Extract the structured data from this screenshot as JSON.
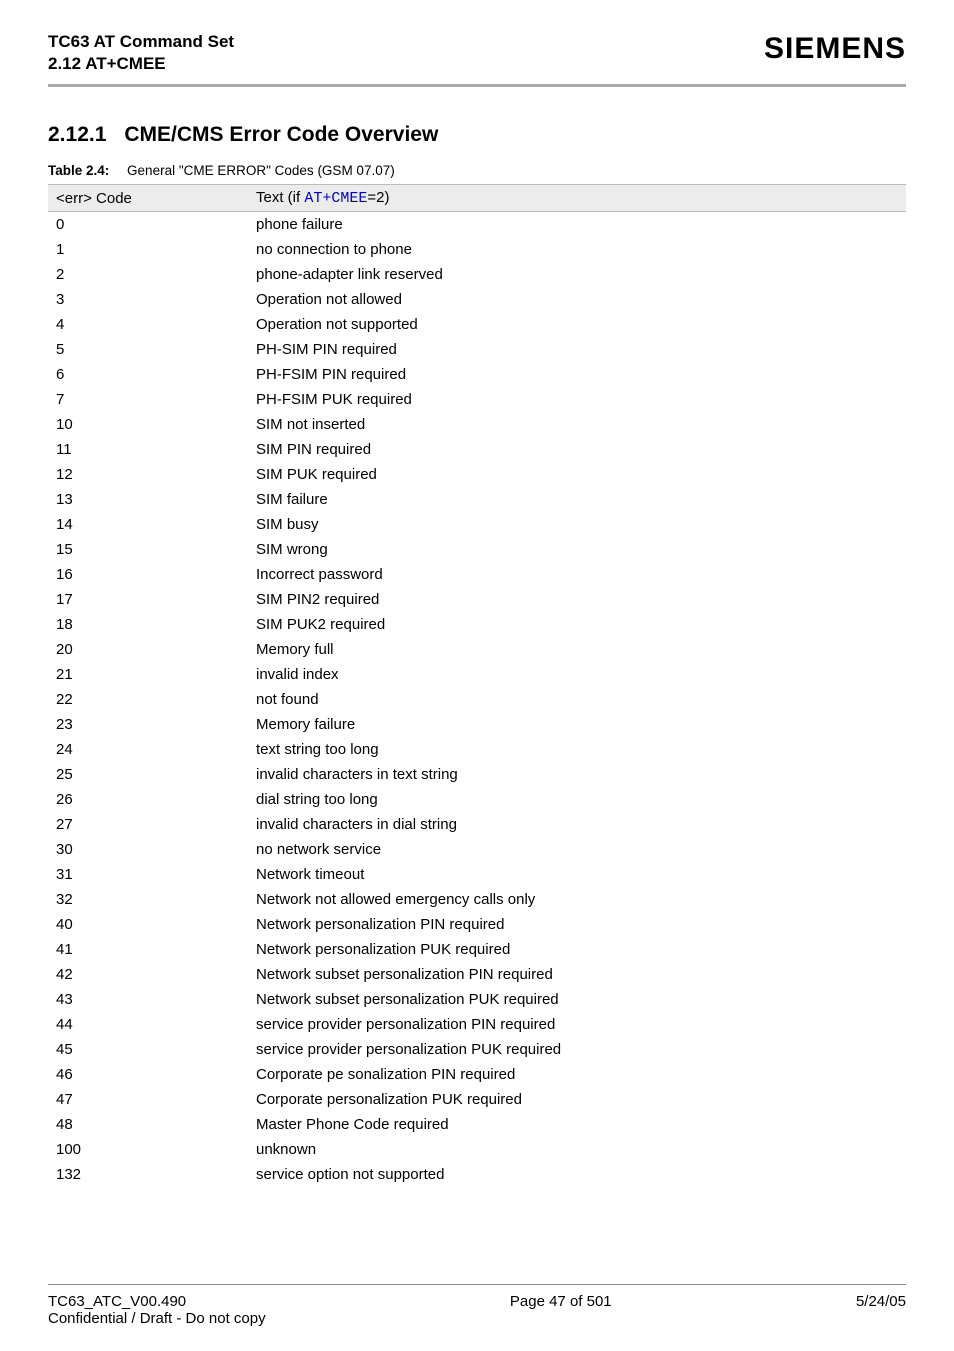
{
  "header": {
    "title_line1": "TC63 AT Command Set",
    "title_line2_prefix": "2.12 ",
    "title_line2_link": "AT+CMEE",
    "brand": "SIEMENS"
  },
  "section": {
    "number": "2.12.1",
    "title": "CME/CMS Error Code Overview"
  },
  "table": {
    "caption_label": "Table 2.4:",
    "caption_text": "General \"CME ERROR\" Codes (GSM 07.07)",
    "header_col1": "<err> Code",
    "header_col2_prefix": "Text (if ",
    "header_col2_link": "AT+CMEE",
    "header_col2_suffix": "=2)",
    "rows": [
      {
        "code": "0",
        "text": "phone failure"
      },
      {
        "code": "1",
        "text": "no connection to phone"
      },
      {
        "code": "2",
        "text": "phone-adapter link reserved"
      },
      {
        "code": "3",
        "text": "Operation not allowed"
      },
      {
        "code": "4",
        "text": "Operation not supported"
      },
      {
        "code": "5",
        "text": "PH-SIM PIN required"
      },
      {
        "code": "6",
        "text": "PH-FSIM PIN required"
      },
      {
        "code": "7",
        "text": "PH-FSIM PUK required"
      },
      {
        "code": "10",
        "text": "SIM not inserted"
      },
      {
        "code": "11",
        "text": "SIM PIN required"
      },
      {
        "code": "12",
        "text": "SIM PUK required"
      },
      {
        "code": "13",
        "text": "SIM failure"
      },
      {
        "code": "14",
        "text": "SIM busy"
      },
      {
        "code": "15",
        "text": "SIM wrong"
      },
      {
        "code": "16",
        "text": "Incorrect password"
      },
      {
        "code": "17",
        "text": "SIM PIN2 required"
      },
      {
        "code": "18",
        "text": "SIM PUK2 required"
      },
      {
        "code": "20",
        "text": "Memory full"
      },
      {
        "code": "21",
        "text": "invalid index"
      },
      {
        "code": "22",
        "text": "not found"
      },
      {
        "code": "23",
        "text": "Memory failure"
      },
      {
        "code": "24",
        "text": "text string too long"
      },
      {
        "code": "25",
        "text": "invalid characters in text string"
      },
      {
        "code": "26",
        "text": "dial string too long"
      },
      {
        "code": "27",
        "text": "invalid characters in dial string"
      },
      {
        "code": "30",
        "text": "no network service"
      },
      {
        "code": "31",
        "text": "Network timeout"
      },
      {
        "code": "32",
        "text": "Network not allowed emergency calls only"
      },
      {
        "code": "40",
        "text": "Network personalization PIN required"
      },
      {
        "code": "41",
        "text": "Network personalization PUK required"
      },
      {
        "code": "42",
        "text": "Network subset personalization PIN required"
      },
      {
        "code": "43",
        "text": "Network subset personalization PUK required"
      },
      {
        "code": "44",
        "text": "service provider personalization PIN required"
      },
      {
        "code": "45",
        "text": "service provider personalization PUK required"
      },
      {
        "code": "46",
        "text": "Corporate pe sonalization PIN required"
      },
      {
        "code": "47",
        "text": "Corporate personalization PUK required"
      },
      {
        "code": "48",
        "text": "Master Phone Code required"
      },
      {
        "code": "100",
        "text": "unknown"
      },
      {
        "code": "132",
        "text": "service option not supported"
      }
    ]
  },
  "footer": {
    "doc_id": "TC63_ATC_V00.490",
    "page": "Page 47 of 501",
    "date": "5/24/05",
    "confidential": "Confidential / Draft - Do not copy"
  }
}
